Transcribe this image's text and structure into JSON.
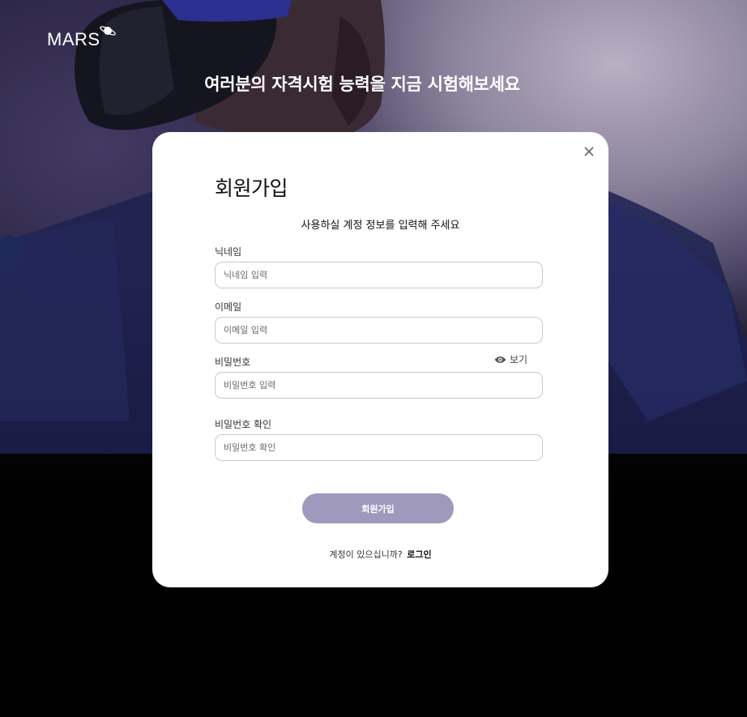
{
  "brand": {
    "logo_text": "MARS",
    "logo_icon": "planet-icon"
  },
  "hero": {
    "headline": "여러분의 자격시험 능력을 지금 시험해보세요"
  },
  "modal": {
    "close_icon": "close-icon",
    "title": "회원가입",
    "subtitle": "사용하실 계정 정보를 입력해 주세요",
    "fields": {
      "nickname": {
        "label": "닉네임",
        "placeholder": "닉네임 입력",
        "value": ""
      },
      "email": {
        "label": "이메일",
        "placeholder": "이메일 입력",
        "value": ""
      },
      "password": {
        "label": "비밀번호",
        "placeholder": "비밀번호 입력",
        "value": ""
      },
      "password_confirm": {
        "label": "비밀번호 확인",
        "placeholder": "비밀번호 확인",
        "value": ""
      }
    },
    "show_password": {
      "label": "보기",
      "icon": "eye-icon"
    },
    "submit_label": "회원가입",
    "footer": {
      "prompt": "계정이 있으십니까?",
      "login_link": "로그인"
    }
  },
  "colors": {
    "submit_button": "#9e99bd",
    "modal_background": "#ffffff",
    "page_background": "#000000"
  }
}
